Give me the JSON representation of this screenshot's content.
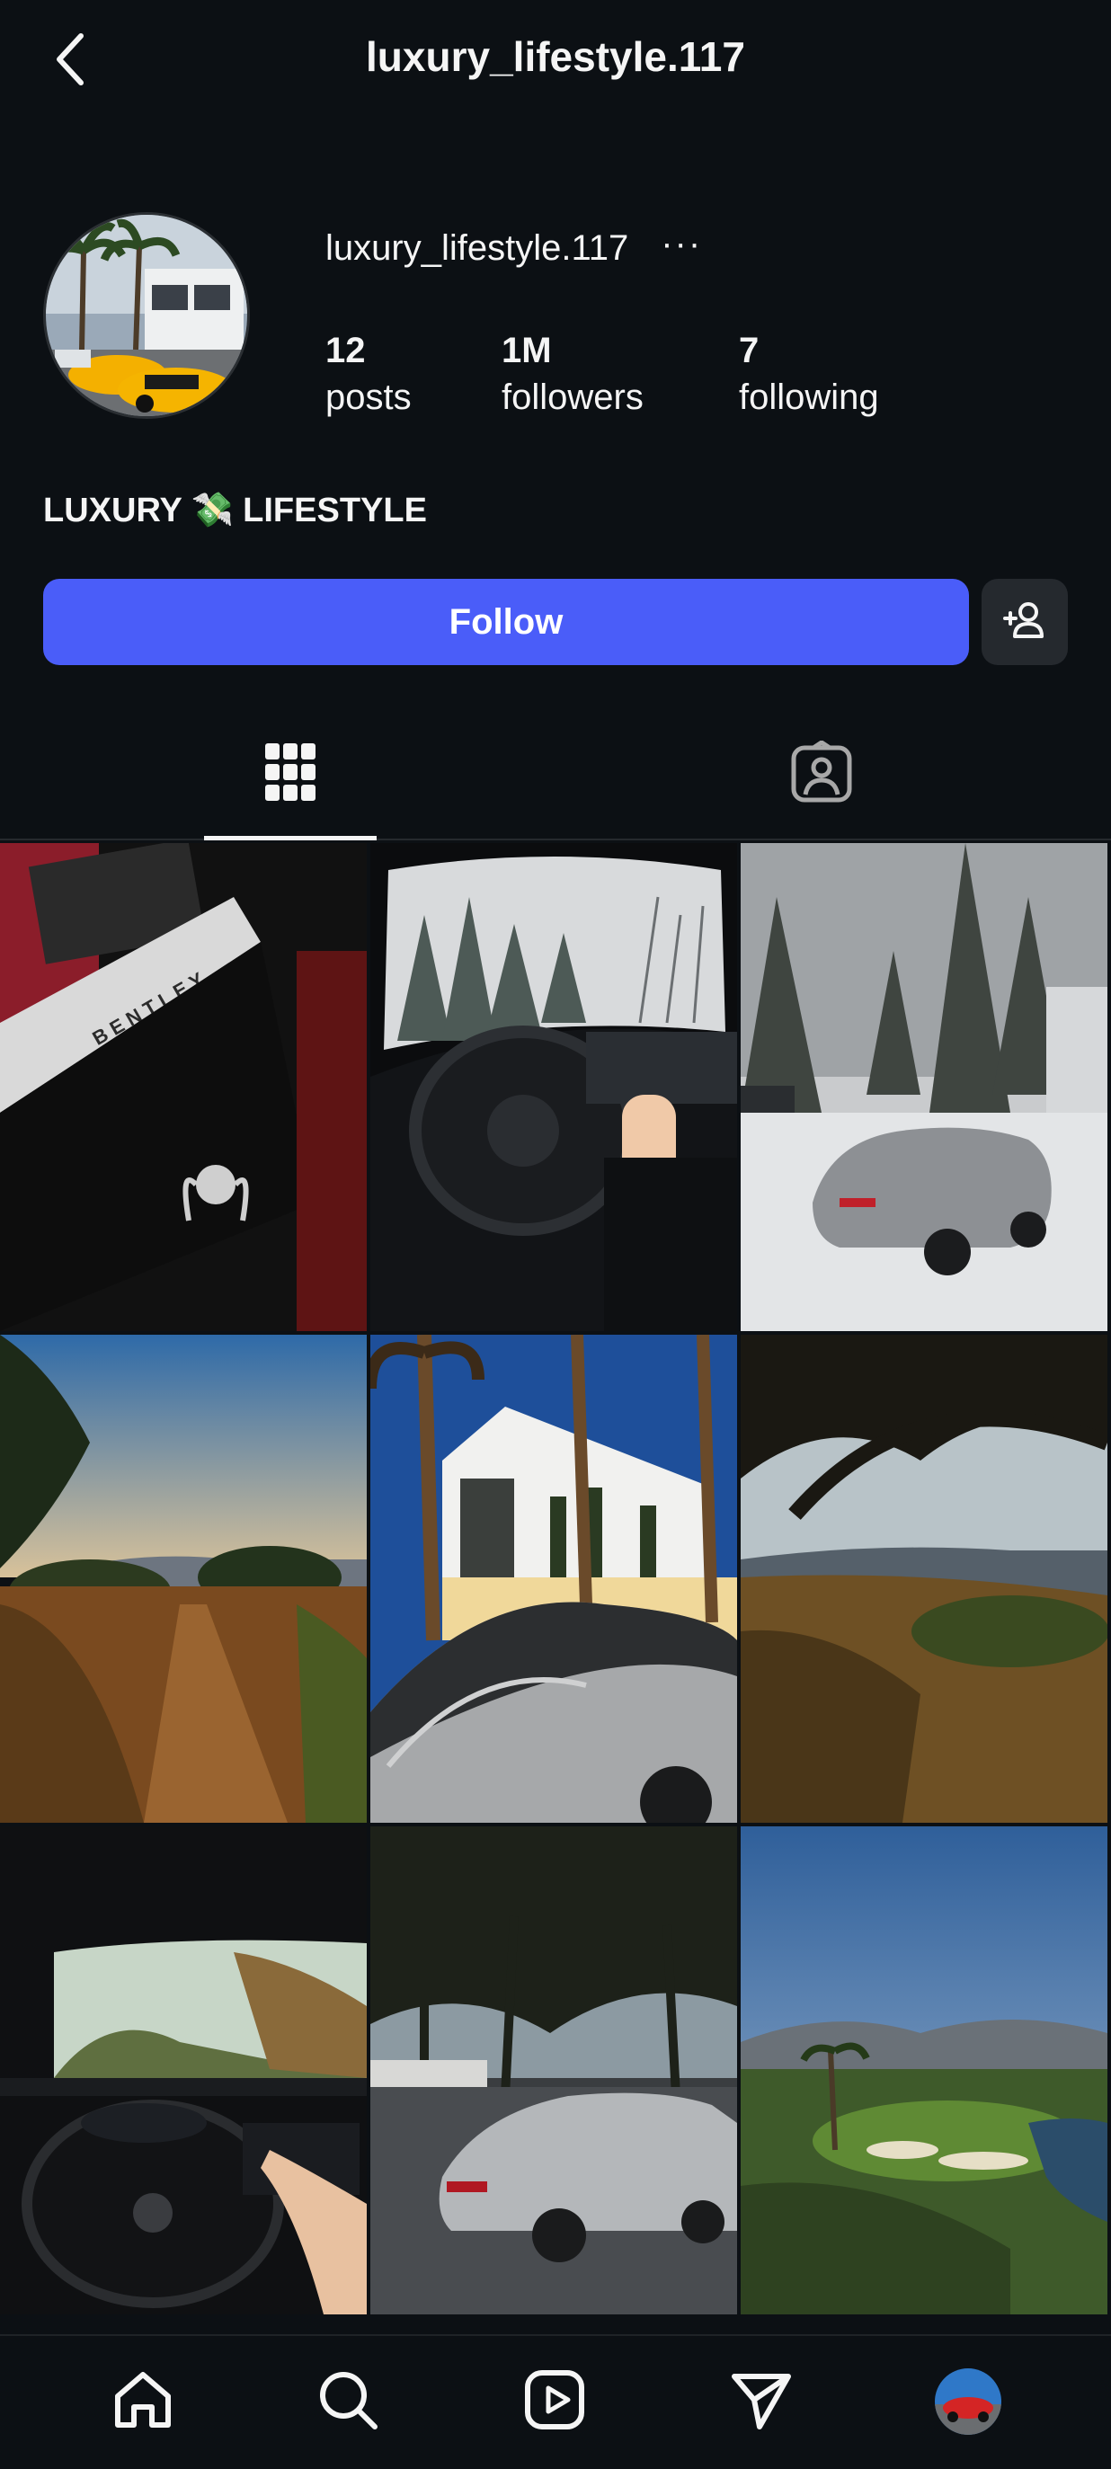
{
  "header": {
    "title": "luxury_lifestyle.117"
  },
  "profile": {
    "username": "luxury_lifestyle.117",
    "posts_count": "12",
    "posts_label": "posts",
    "followers_count": "1M",
    "followers_label": "followers",
    "following_count": "7",
    "following_label": "following",
    "bio_left": "LUXURY",
    "bio_emoji": "💸",
    "bio_right": "LIFESTYLE"
  },
  "actions": {
    "follow_label": "Follow",
    "suggest_icon": "add-person-icon"
  },
  "tabs": [
    {
      "icon": "grid-icon",
      "active": true
    },
    {
      "icon": "tagged-icon",
      "active": false
    }
  ],
  "posts": [
    "bentley-door-sill-post",
    "snowy-drive-interior-post",
    "snow-porsche-post",
    "sunset-trail-post",
    "villa-palm-porsche-post",
    "tree-hillside-view-post",
    "porsche-dashboard-drive-post",
    "silver-porsche-street-post",
    "golf-course-view-post"
  ],
  "bottom_nav": [
    "home-icon",
    "search-icon",
    "reels-icon",
    "direct-messages-icon",
    "profile-avatar"
  ],
  "colors": {
    "background": "#0c1014",
    "accent": "#4a5df9",
    "secondary_button": "#25292e"
  }
}
